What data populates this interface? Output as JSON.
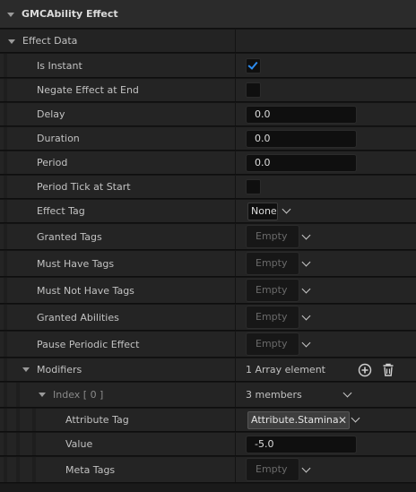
{
  "header": {
    "title": "GMCAbility Effect"
  },
  "section": {
    "title": "Effect Data"
  },
  "rows": {
    "is_instant": {
      "label": "Is Instant",
      "checked": true
    },
    "negate_effect_at_end": {
      "label": "Negate Effect at End",
      "checked": false
    },
    "delay": {
      "label": "Delay",
      "value": "0.0"
    },
    "duration": {
      "label": "Duration",
      "value": "0.0"
    },
    "period": {
      "label": "Period",
      "value": "0.0"
    },
    "period_tick_at_start": {
      "label": "Period Tick at Start",
      "checked": false
    },
    "effect_tag": {
      "label": "Effect Tag",
      "value": "None"
    },
    "granted_tags": {
      "label": "Granted Tags",
      "placeholder": "Empty"
    },
    "must_have_tags": {
      "label": "Must Have Tags",
      "placeholder": "Empty"
    },
    "must_not_have_tags": {
      "label": "Must Not Have Tags",
      "placeholder": "Empty"
    },
    "granted_abilities": {
      "label": "Granted Abilities",
      "placeholder": "Empty"
    },
    "pause_periodic_effect": {
      "label": "Pause Periodic Effect",
      "placeholder": "Empty"
    },
    "modifiers": {
      "label": "Modifiers",
      "summary": "1 Array element"
    },
    "index0": {
      "label": "Index [ 0 ]",
      "summary": "3 members"
    },
    "attribute_tag": {
      "label": "Attribute Tag",
      "value": "Attribute.Stamina"
    },
    "value": {
      "label": "Value",
      "value": "-5.0"
    },
    "meta_tags": {
      "label": "Meta Tags",
      "placeholder": "Empty"
    }
  },
  "icons": {
    "add": "plus-circle-icon",
    "delete": "trash-icon",
    "check_color": "#2d8cf0"
  }
}
